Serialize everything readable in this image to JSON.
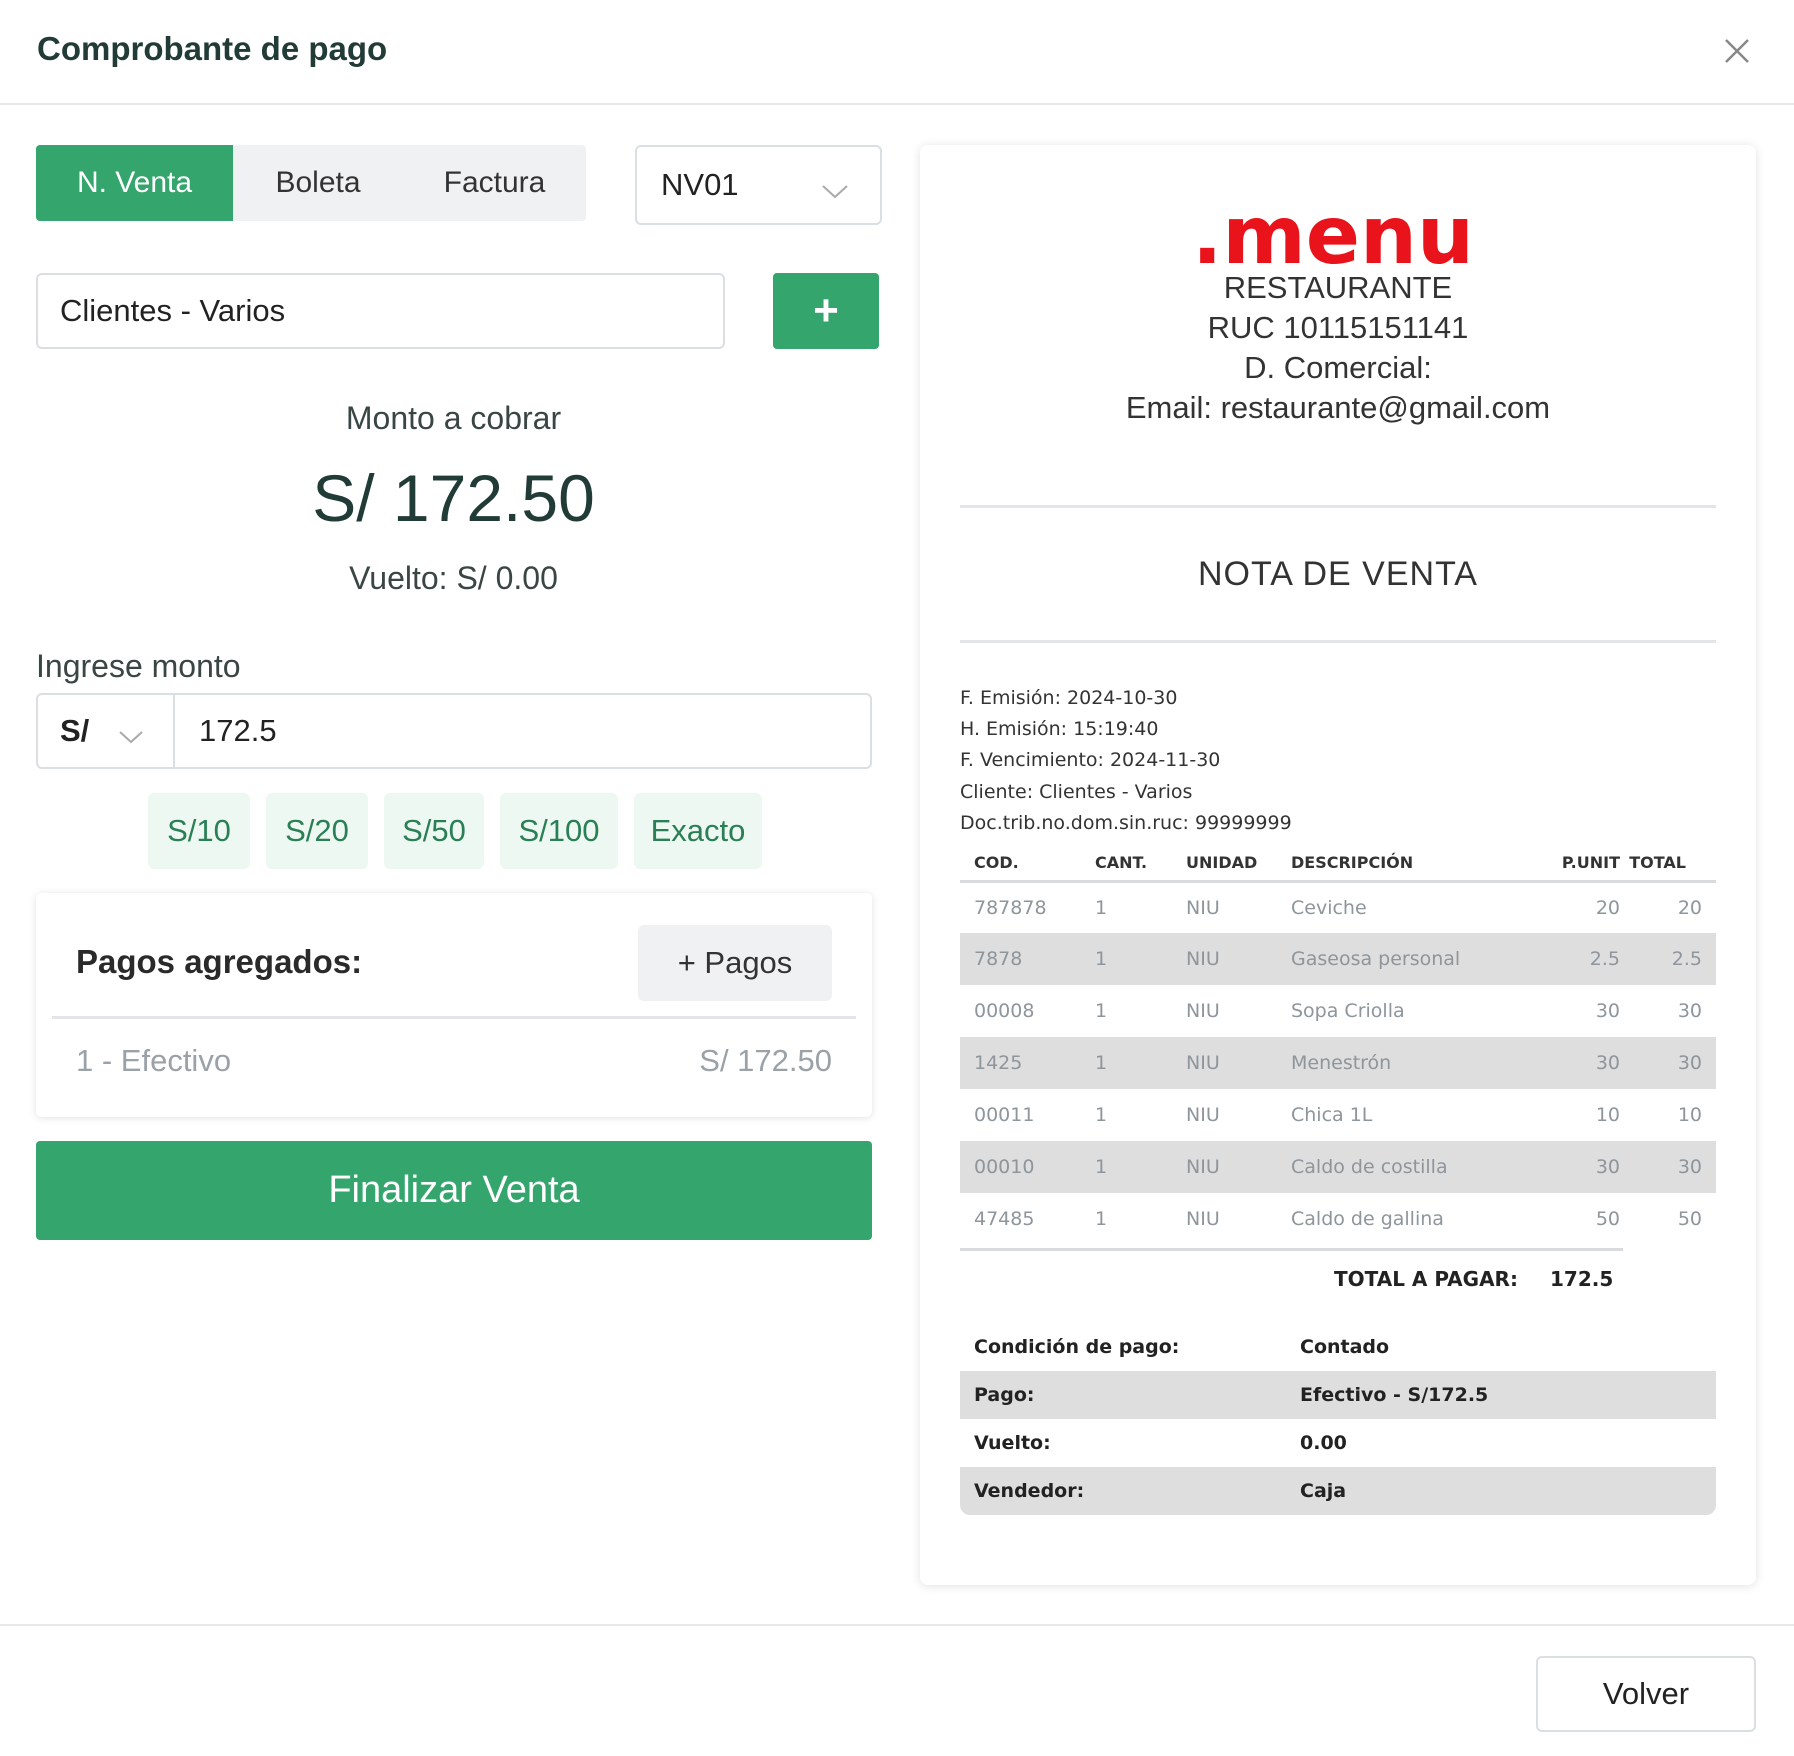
{
  "header": {
    "title": "Comprobante de pago",
    "close_icon": "close-icon"
  },
  "doc_types": {
    "nventa": "N. Venta",
    "boleta": "Boleta",
    "factura": "Factura",
    "active": "N. Venta"
  },
  "serie": {
    "value": "NV01"
  },
  "client": {
    "value": "Clientes - Varios",
    "add_label": "+"
  },
  "amount": {
    "label": "Monto a cobrar",
    "value": "S/ 172.50",
    "change": "Vuelto: S/ 0.00"
  },
  "entry": {
    "label": "Ingrese monto",
    "currency": "S/",
    "value": "172.5"
  },
  "quick_amounts": [
    "S/10",
    "S/20",
    "S/50",
    "S/100",
    "Exacto"
  ],
  "payments": {
    "title": "Pagos agregados:",
    "add_label": "+ Pagos",
    "row_label": "1 - Efectivo",
    "row_amount": "S/ 172.50"
  },
  "finalize_label": "Finalizar Venta",
  "receipt": {
    "logo_text": ".menu",
    "company": "RESTAURANTE",
    "ruc": "RUC 10115151141",
    "commercial": "D. Comercial:",
    "email": "Email: restaurante@gmail.com",
    "doc_title": "NOTA DE VENTA",
    "meta": {
      "issue_date": "F. Emisión: 2024-10-30",
      "issue_time": "H. Emisión: 15:19:40",
      "due_date": "F. Vencimiento: 2024-11-30",
      "client": "Cliente: Clientes - Varios",
      "doc": "Doc.trib.no.dom.sin.ruc: 99999999"
    },
    "columns": {
      "cod": "COD.",
      "cant": "CANT.",
      "unidad": "UNIDAD",
      "desc": "DESCRIPCIÓN",
      "punit": "P.UNIT",
      "total": "TOTAL"
    },
    "items": [
      {
        "cod": "787878",
        "cant": "1",
        "unidad": "NIU",
        "desc": "Ceviche",
        "punit": "20",
        "total": "20"
      },
      {
        "cod": "7878",
        "cant": "1",
        "unidad": "NIU",
        "desc": "Gaseosa personal",
        "punit": "2.5",
        "total": "2.5"
      },
      {
        "cod": "00008",
        "cant": "1",
        "unidad": "NIU",
        "desc": "Sopa Criolla",
        "punit": "30",
        "total": "30"
      },
      {
        "cod": "1425",
        "cant": "1",
        "unidad": "NIU",
        "desc": "Menestrón",
        "punit": "30",
        "total": "30"
      },
      {
        "cod": "00011",
        "cant": "1",
        "unidad": "NIU",
        "desc": "Chica 1L",
        "punit": "10",
        "total": "10"
      },
      {
        "cod": "00010",
        "cant": "1",
        "unidad": "NIU",
        "desc": "Caldo de costilla",
        "punit": "30",
        "total": "30"
      },
      {
        "cod": "47485",
        "cant": "1",
        "unidad": "NIU",
        "desc": "Caldo de gallina",
        "punit": "50",
        "total": "50"
      }
    ],
    "total_label": "TOTAL A PAGAR:",
    "total_value": "172.5",
    "conditions": [
      {
        "label": "Condición de pago:",
        "value": "Contado"
      },
      {
        "label": "Pago:",
        "value": "Efectivo - S/172.5"
      },
      {
        "label": "Vuelto:",
        "value": "0.00"
      },
      {
        "label": "Vendedor:",
        "value": "Caja"
      }
    ]
  },
  "footer": {
    "back_label": "Volver"
  },
  "colors": {
    "accent": "#34a56c",
    "logo_red": "#e8131b",
    "quick_bg": "#eef8f2",
    "row_alt": "#dedede"
  }
}
